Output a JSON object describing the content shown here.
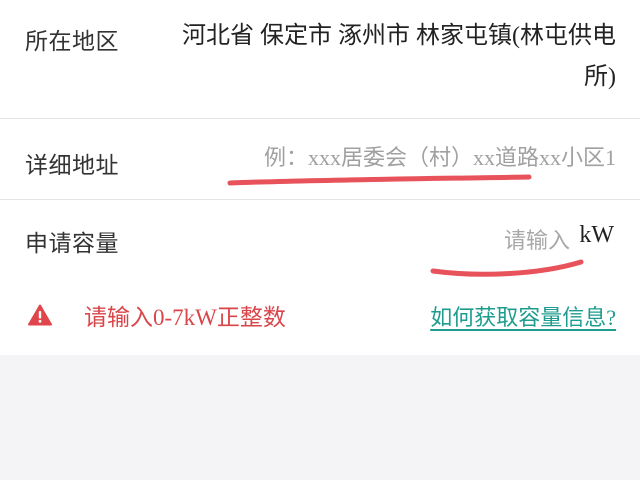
{
  "region": {
    "label": "所在地区",
    "value_line1": "河北省 保定市 涿州市 林家屯镇(林屯供电",
    "value_line2": "所)"
  },
  "address": {
    "label": "详细地址",
    "placeholder": "例：xxx居委会（村）xx道路xx小区1",
    "value": ""
  },
  "capacity": {
    "label": "申请容量",
    "placeholder": "请输入",
    "value": "",
    "unit": "kW",
    "error_icon": "warning-triangle-icon",
    "error_text": "请输入0-7kW正整数",
    "help_link": "如何获取容量信息?"
  },
  "colors": {
    "error": "#d9464a",
    "link": "#1e9c8e",
    "annotation": "#e8525a",
    "page_background": "#f4f4f6"
  }
}
